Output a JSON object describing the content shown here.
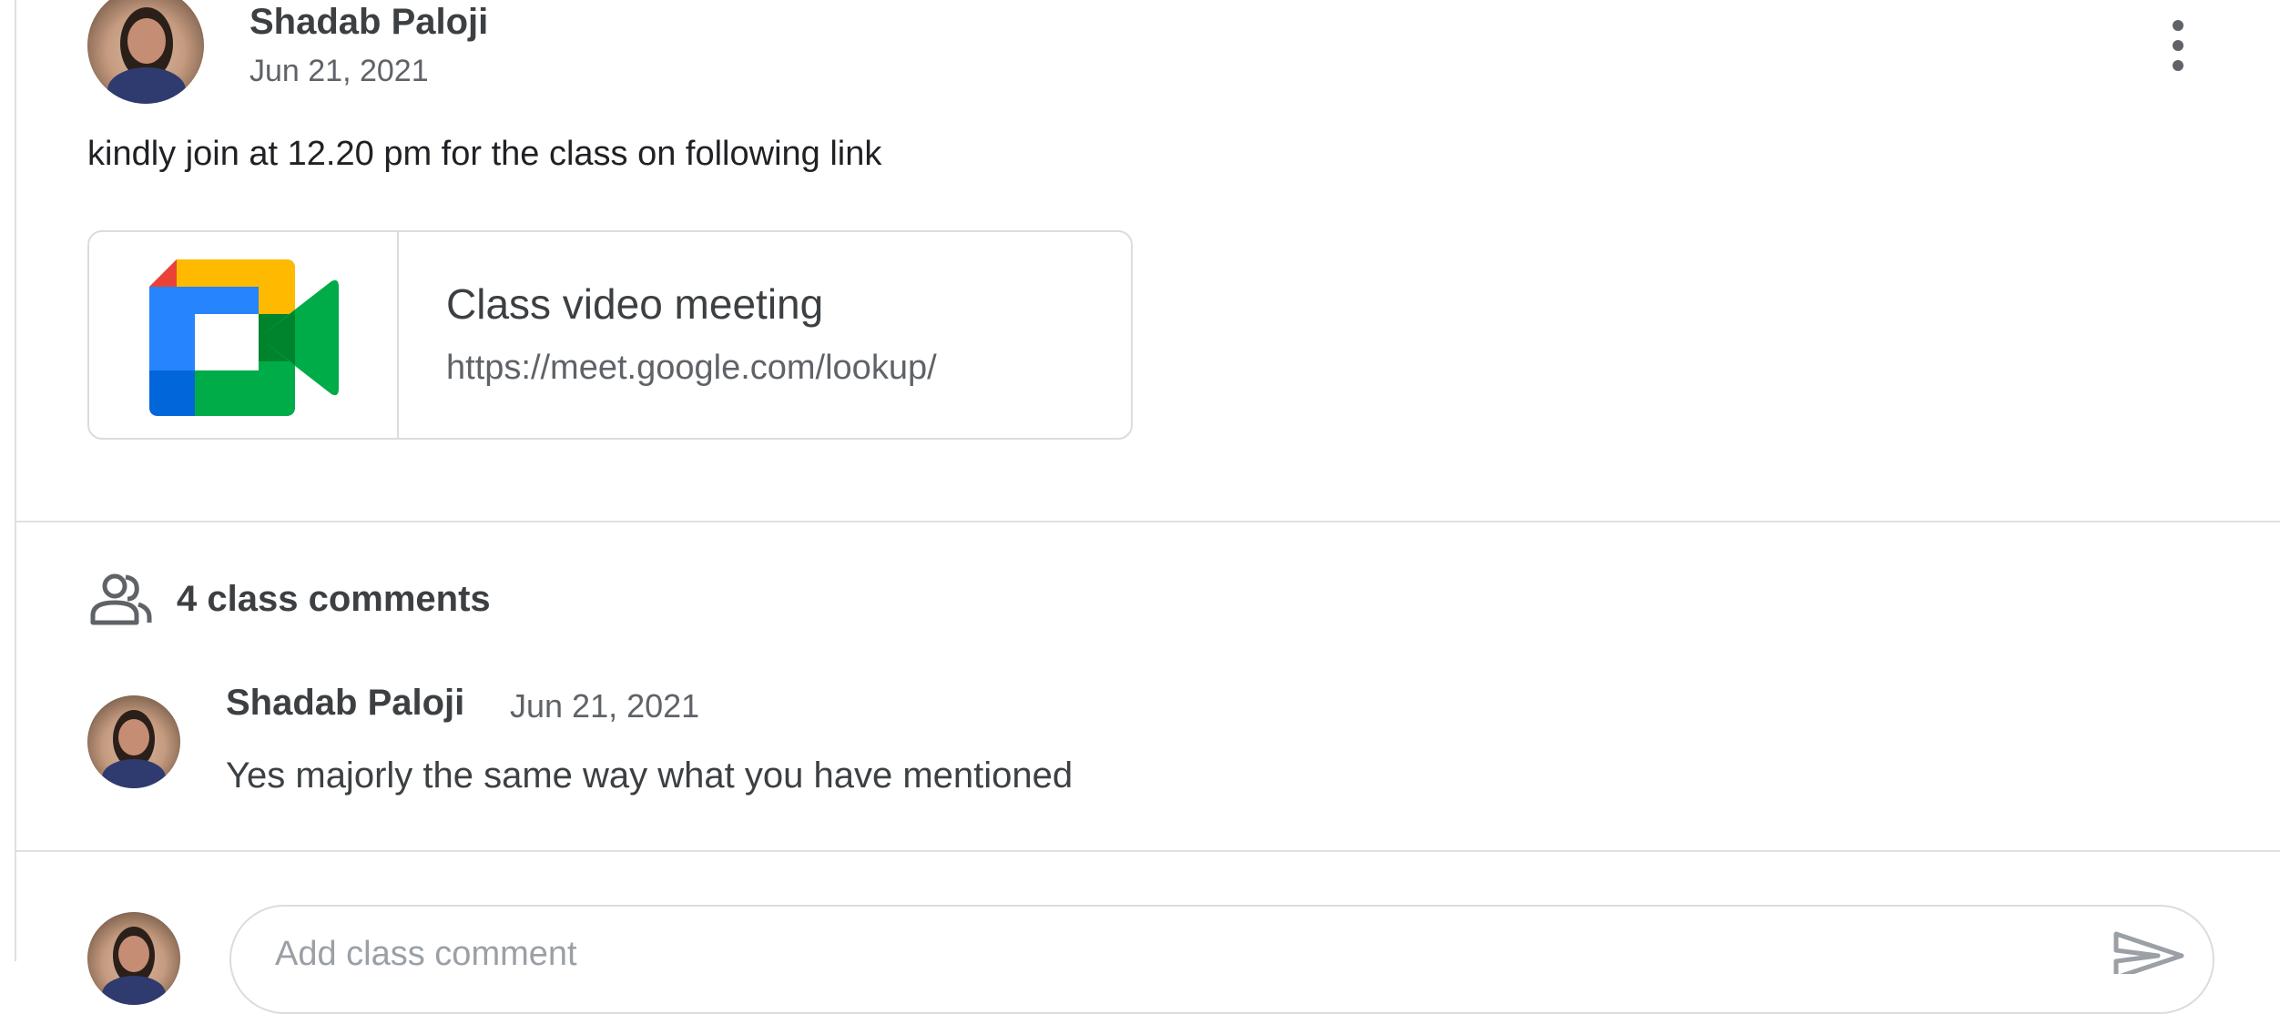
{
  "post": {
    "author": "Shadab Paloji",
    "date": "Jun 21, 2021",
    "body": "kindly join at 12.20 pm for the class on following link",
    "menu_icon": "more-vert-icon",
    "attachment": {
      "title": "Class video meeting",
      "link": "https://meet.google.com/lookup/",
      "icon": "google-meet-icon"
    }
  },
  "comments": {
    "header_icon": "people-icon",
    "header_label": "4 class comments",
    "items": [
      {
        "author": "Shadab Paloji",
        "date": "Jun 21, 2021",
        "text": "Yes majorly the same way what you have mentioned"
      }
    ]
  },
  "compose": {
    "placeholder": "Add class comment",
    "send_icon": "send-icon"
  },
  "colors": {
    "text_primary": "#3c4043",
    "text_secondary": "#5f6368",
    "border": "#dadce0",
    "meet_green": "#00832d",
    "meet_blue": "#2684fc",
    "meet_yellow": "#ffba00",
    "meet_red": "#ea4335"
  }
}
